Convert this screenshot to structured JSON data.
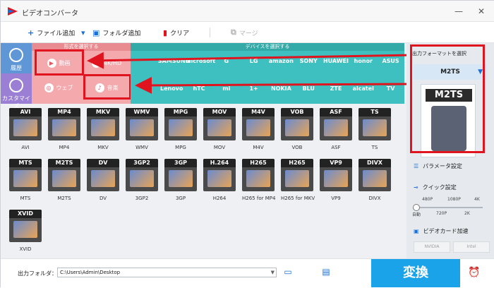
{
  "window": {
    "title": "ビデオコンバータ",
    "minimize": "—",
    "close": "✕"
  },
  "toolbar": {
    "add_file": "ファイル追加",
    "add_folder": "フォルダ追加",
    "clear": "クリア",
    "merge": "マージ"
  },
  "left_nav": {
    "history": "履歴",
    "customize": "カスタマイズ"
  },
  "category": {
    "label": "形式を選択する",
    "items": [
      {
        "label": "動画",
        "icon": "play-icon"
      },
      {
        "label": "4K/HD",
        "icon": "4k-icon"
      },
      {
        "label": "ウェブ",
        "icon": "chrome-icon"
      },
      {
        "label": "音楽",
        "icon": "speaker-icon"
      }
    ]
  },
  "devices": {
    "label": "デバイスを選択する",
    "row1": [
      "",
      "SAMSUNG",
      "Microsoft",
      "G",
      "LG",
      "amazon",
      "SONY",
      "HUAWEI",
      "honor",
      "ASUS"
    ],
    "row2": [
      "",
      "Lenovo",
      "hTC",
      "mi",
      "1+",
      "NOKIA",
      "BLU",
      "ZTE",
      "alcatel",
      "TV"
    ]
  },
  "formats": [
    {
      "badge": "AVI",
      "name": "AVI"
    },
    {
      "badge": "MP4",
      "name": "MP4"
    },
    {
      "badge": "MKV",
      "name": "MKV"
    },
    {
      "badge": "WMV",
      "name": "WMV"
    },
    {
      "badge": "MPG",
      "name": "MPG"
    },
    {
      "badge": "MOV",
      "name": "MOV"
    },
    {
      "badge": "M4V",
      "name": "M4V"
    },
    {
      "badge": "VOB",
      "name": "VOB"
    },
    {
      "badge": "ASF",
      "name": "ASF"
    },
    {
      "badge": "TS",
      "name": "TS"
    },
    {
      "badge": "MTS",
      "name": "MTS"
    },
    {
      "badge": "M2TS",
      "name": "M2TS"
    },
    {
      "badge": "DV",
      "name": "DV"
    },
    {
      "badge": "3GP2",
      "name": "3GP2"
    },
    {
      "badge": "3GP",
      "name": "3GP"
    },
    {
      "badge": "H.264",
      "name": "H264"
    },
    {
      "badge": "H265",
      "name": "H265 for MP4"
    },
    {
      "badge": "H265",
      "name": "H265 for MKV"
    },
    {
      "badge": "VP9",
      "name": "VP9"
    },
    {
      "badge": "DIVX",
      "name": "DIVX"
    },
    {
      "badge": "XVID",
      "name": "XVID"
    }
  ],
  "output_panel": {
    "title": "出力フォーマットを選択",
    "selected": "M2TS",
    "preview_badge": "M2TS",
    "param_settings": "パラメータ設定",
    "quick_settings": "クイック設定",
    "quality_top": [
      "480P",
      "1080P",
      "4K"
    ],
    "quality_bottom": [
      "自動",
      "720P",
      "2K"
    ],
    "gpu_accel": "ビデオカード加速",
    "gpu_vendors": [
      "NVIDIA",
      "Intel"
    ]
  },
  "bottom": {
    "output_label": "出力フォルダ：",
    "output_path": "C:\\Users\\Admin\\Desktop",
    "convert": "変換"
  },
  "colors": {
    "accent": "#1aa3e8",
    "highlight": "#e0141e",
    "category_bg": "#f4a9ad",
    "device_bg": "#3dc0bf"
  }
}
